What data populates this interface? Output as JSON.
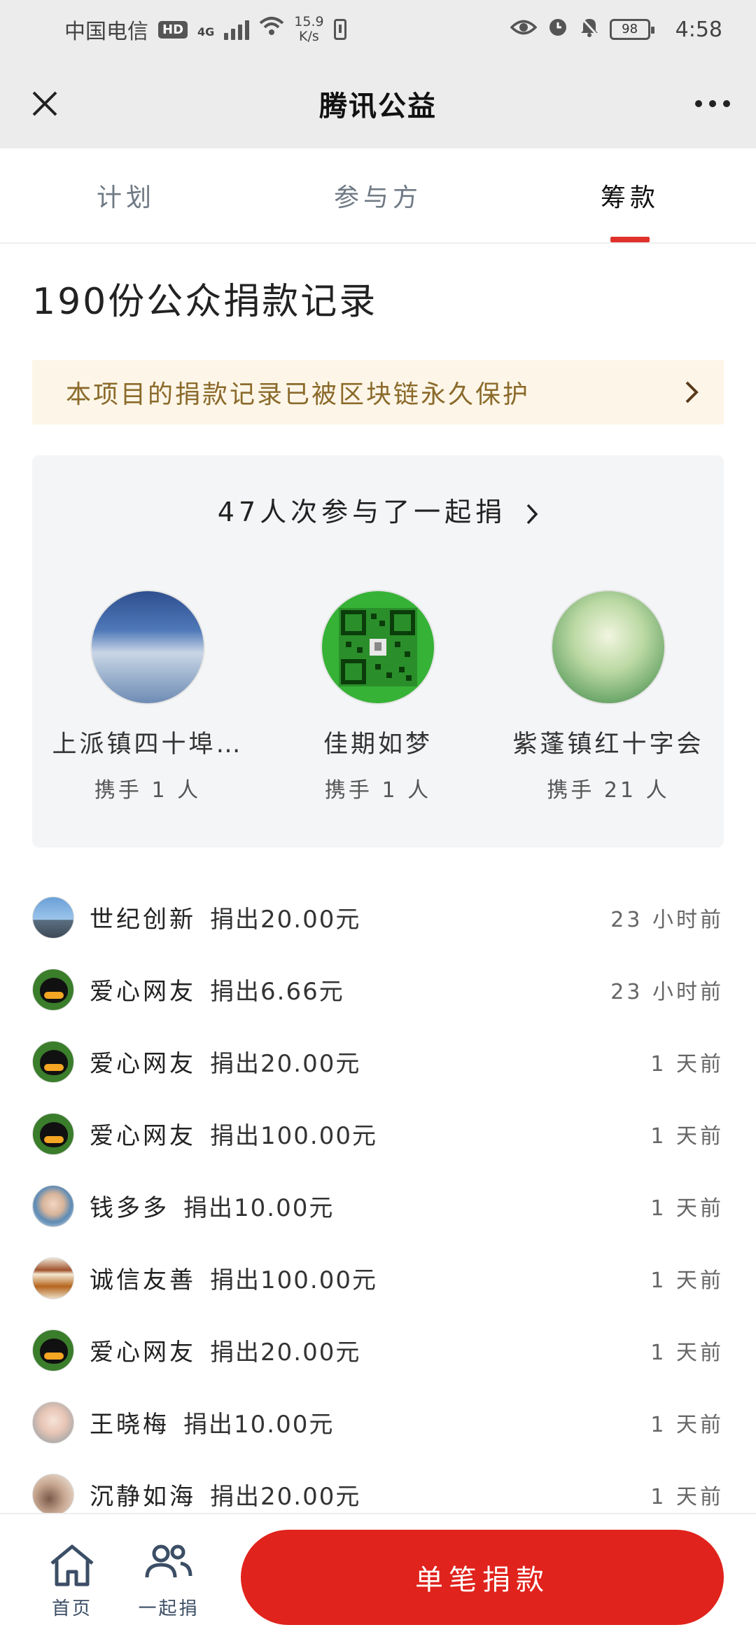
{
  "status_bar": {
    "carrier": "中国电信",
    "hd": "HD",
    "network": "4G",
    "speed_value": "15.9",
    "speed_unit": "K/s",
    "battery": "98",
    "time": "4:58"
  },
  "titlebar": {
    "title": "腾讯公益"
  },
  "tabs": [
    {
      "label": "计划",
      "active": false
    },
    {
      "label": "参与方",
      "active": false
    },
    {
      "label": "筹款",
      "active": true
    }
  ],
  "records": {
    "title": "190份公众捐款记录",
    "chain_notice": "本项目的捐款记录已被区块链永久保护"
  },
  "together": {
    "header": "47人次参与了一起捐",
    "teams": [
      {
        "name": "上派镇四十埠…",
        "count": "携手 1 人",
        "avatar_icon": "sky-photo"
      },
      {
        "name": "佳期如梦",
        "count": "携手 1 人",
        "avatar_icon": "qr-code"
      },
      {
        "name": "紫蓬镇红十字会",
        "count": "携手 21 人",
        "avatar_icon": "forest-painting"
      }
    ]
  },
  "donations": [
    {
      "name": "世纪创新",
      "amount": "捐出20.00元",
      "time": "23 小时前",
      "avatar": "city"
    },
    {
      "name": "爱心网友",
      "amount": "捐出6.66元",
      "time": "23 小时前",
      "avatar": "qq"
    },
    {
      "name": "爱心网友",
      "amount": "捐出20.00元",
      "time": "1 天前",
      "avatar": "qq"
    },
    {
      "name": "爱心网友",
      "amount": "捐出100.00元",
      "time": "1 天前",
      "avatar": "qq"
    },
    {
      "name": "钱多多",
      "amount": "捐出10.00元",
      "time": "1 天前",
      "avatar": "kid"
    },
    {
      "name": "诚信友善",
      "amount": "捐出100.00元",
      "time": "1 天前",
      "avatar": "plaque"
    },
    {
      "name": "爱心网友",
      "amount": "捐出20.00元",
      "time": "1 天前",
      "avatar": "qq"
    },
    {
      "name": "王晓梅",
      "amount": "捐出10.00元",
      "time": "1 天前",
      "avatar": "baby"
    },
    {
      "name": "沉静如海",
      "amount": "捐出20.00元",
      "time": "1 天前",
      "avatar": "calm"
    }
  ],
  "bottom_nav": {
    "home_label": "首页",
    "together_label": "一起捐",
    "donate_label": "单笔捐款"
  },
  "colors": {
    "accent_red": "#e0231c",
    "notice_bg": "#fdf6e8",
    "notice_text": "#8b6a2b",
    "card_bg": "#f4f5f7"
  }
}
